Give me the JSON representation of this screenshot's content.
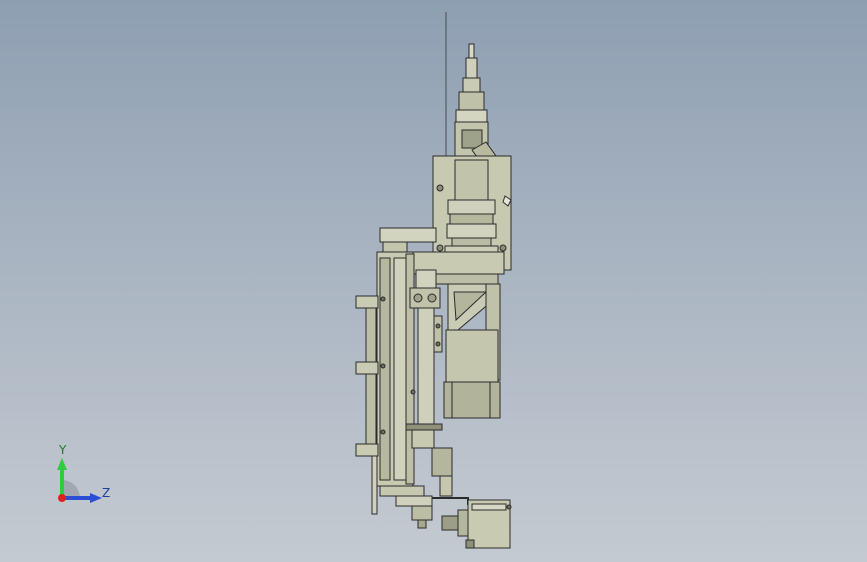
{
  "viewport": {
    "background_top": "#8e9fb2",
    "background_bottom": "#c4cad1",
    "model_fill": "#c9cbb3",
    "model_edge": "#2b2b2b"
  },
  "triad": {
    "y_label": "Y",
    "z_label": "Z",
    "y_color": "#2ecc40",
    "z_color": "#2a4fd6",
    "x_color": "#e02020"
  }
}
